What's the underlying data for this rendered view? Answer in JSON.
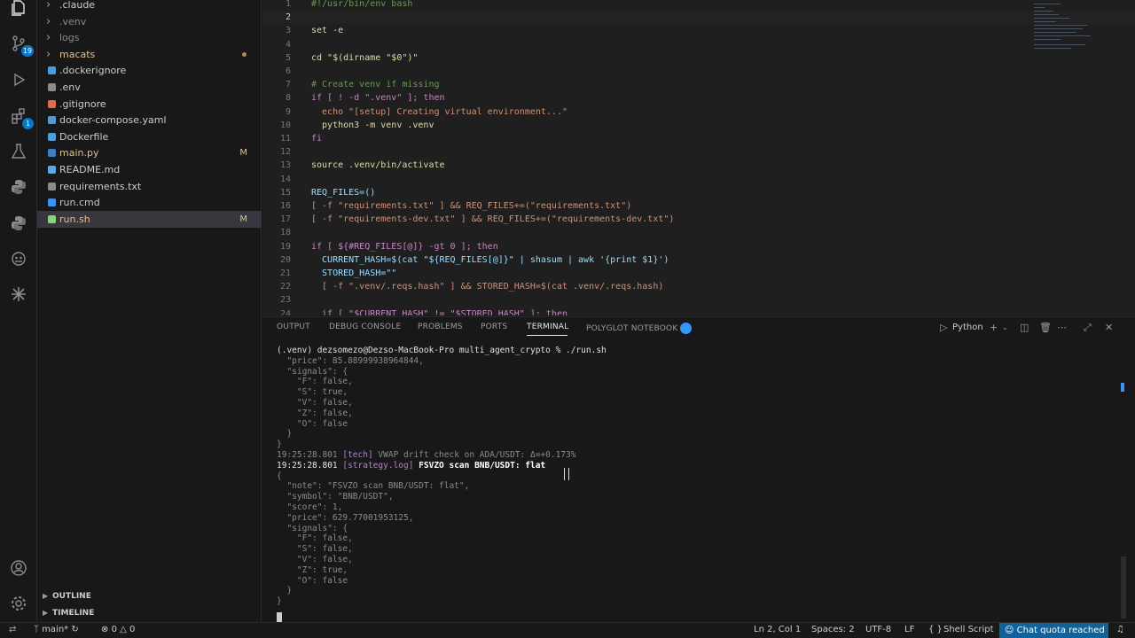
{
  "activity_bar": {
    "items": [
      {
        "name": "explorer-icon",
        "badge": ""
      },
      {
        "name": "source-control-icon",
        "badge": "19"
      },
      {
        "name": "run-debug-icon",
        "badge": ""
      },
      {
        "name": "extensions-icon",
        "badge": "1"
      },
      {
        "name": "testing-icon",
        "badge": ""
      },
      {
        "name": "python-icon",
        "badge": ""
      },
      {
        "name": "python-env-icon",
        "badge": ""
      },
      {
        "name": "copilot-icon",
        "badge": ""
      },
      {
        "name": "spark-icon",
        "badge": ""
      }
    ]
  },
  "explorer": {
    "items": [
      {
        "label": ".claude",
        "kind": "folder",
        "git": "",
        "color": "#cccccc"
      },
      {
        "label": ".venv",
        "kind": "folder",
        "git": "",
        "color": "#8b8b8b"
      },
      {
        "label": "logs",
        "kind": "folder",
        "git": "",
        "color": "#8b8b8b"
      },
      {
        "label": "macats",
        "kind": "folder",
        "git": "dot",
        "color": "#e2c08d"
      },
      {
        "label": ".dockerignore",
        "kind": "docker",
        "git": "",
        "color": "#cccccc"
      },
      {
        "label": ".env",
        "kind": "gear",
        "git": "",
        "color": "#cccccc"
      },
      {
        "label": ".gitignore",
        "kind": "git",
        "git": "",
        "color": "#cccccc"
      },
      {
        "label": "docker-compose.yaml",
        "kind": "docker",
        "git": "",
        "color": "#cccccc"
      },
      {
        "label": "Dockerfile",
        "kind": "docker",
        "git": "",
        "color": "#cccccc"
      },
      {
        "label": "main.py",
        "kind": "python",
        "git": "M",
        "color": "#e2c08d"
      },
      {
        "label": "README.md",
        "kind": "info",
        "git": "",
        "color": "#cccccc"
      },
      {
        "label": "requirements.txt",
        "kind": "text",
        "git": "",
        "color": "#cccccc"
      },
      {
        "label": "run.cmd",
        "kind": "cmd",
        "git": "",
        "color": "#cccccc"
      },
      {
        "label": "run.sh",
        "kind": "shell",
        "git": "M",
        "color": "#e2c08d"
      }
    ],
    "outline_label": "OUTLINE",
    "timeline_label": "TIMELINE"
  },
  "editor": {
    "lines": [
      {
        "n": "1",
        "text": "#!/usr/bin/env bash",
        "color": "#6a9955"
      },
      {
        "n": "2",
        "text": "",
        "color": "#cccccc"
      },
      {
        "n": "3",
        "text": "set -e",
        "color": "#dcdcaa"
      },
      {
        "n": "4",
        "text": "",
        "color": "#cccccc"
      },
      {
        "n": "5",
        "text": "cd \"$(dirname \"$0\")\"",
        "color": "#dcdcaa"
      },
      {
        "n": "6",
        "text": "",
        "color": "#cccccc"
      },
      {
        "n": "7",
        "text": "# Create venv if missing",
        "color": "#6a9955"
      },
      {
        "n": "8",
        "text": "if [ ! -d \".venv\" ]; then",
        "color": "#c586c0"
      },
      {
        "n": "9",
        "text": "  echo \"[setup] Creating virtual environment...\"",
        "color": "#ce9178"
      },
      {
        "n": "10",
        "text": "  python3 -m venv .venv",
        "color": "#dcdcaa"
      },
      {
        "n": "11",
        "text": "fi",
        "color": "#c586c0"
      },
      {
        "n": "12",
        "text": "",
        "color": "#cccccc"
      },
      {
        "n": "13",
        "text": "source .venv/bin/activate",
        "color": "#dcdcaa"
      },
      {
        "n": "14",
        "text": "",
        "color": "#cccccc"
      },
      {
        "n": "15",
        "text": "REQ_FILES=()",
        "color": "#9cdcfe"
      },
      {
        "n": "16",
        "text": "[ -f \"requirements.txt\" ] && REQ_FILES+=(\"requirements.txt\")",
        "color": "#ce9178"
      },
      {
        "n": "17",
        "text": "[ -f \"requirements-dev.txt\" ] && REQ_FILES+=(\"requirements-dev.txt\")",
        "color": "#ce9178"
      },
      {
        "n": "18",
        "text": "",
        "color": "#cccccc"
      },
      {
        "n": "19",
        "text": "if [ ${#REQ_FILES[@]} -gt 0 ]; then",
        "color": "#c586c0"
      },
      {
        "n": "20",
        "text": "  CURRENT_HASH=$(cat \"${REQ_FILES[@]}\" | shasum | awk '{print $1}')",
        "color": "#9cdcfe"
      },
      {
        "n": "21",
        "text": "  STORED_HASH=\"\"",
        "color": "#9cdcfe"
      },
      {
        "n": "22",
        "text": "  [ -f \".venv/.reqs.hash\" ] && STORED_HASH=$(cat .venv/.reqs.hash)",
        "color": "#ce9178"
      },
      {
        "n": "23",
        "text": "",
        "color": "#cccccc"
      },
      {
        "n": "24",
        "text": "  if [ \"$CURRENT_HASH\" != \"$STORED_HASH\" ]; then",
        "color": "#c586c0"
      }
    ]
  },
  "panel": {
    "tabs": [
      {
        "label": "OUTPUT",
        "active": false
      },
      {
        "label": "DEBUG CONSOLE",
        "active": false
      },
      {
        "label": "PROBLEMS",
        "active": false
      },
      {
        "label": "PORTS",
        "active": false
      },
      {
        "label": "TERMINAL",
        "active": true
      },
      {
        "label": "POLYGLOT NOTEBOOK",
        "active": false
      }
    ],
    "shell_label": "Python",
    "terminal_lines": [
      {
        "text": "(.venv) dezsomezo@Dezso-MacBook-Pro multi_agent_crypto % ./run.sh",
        "style": "prompt"
      },
      {
        "text": "  \"price\": 85.88999938964844,",
        "style": ""
      },
      {
        "text": "  \"signals\": {",
        "style": ""
      },
      {
        "text": "    \"F\": false,",
        "style": ""
      },
      {
        "text": "    \"S\": true,",
        "style": ""
      },
      {
        "text": "    \"V\": false,",
        "style": ""
      },
      {
        "text": "    \"Z\": false,",
        "style": ""
      },
      {
        "text": "    \"O\": false",
        "style": ""
      },
      {
        "text": "  }",
        "style": ""
      },
      {
        "text": "}",
        "style": ""
      },
      {
        "text": "19:25:28.801 [tech] VWAP drift check on ADA/USDT: Δ=+0.173%",
        "style": ""
      },
      {
        "text": "19:25:28.801 [strategy.log] FSVZO scan BNB/USDT: flat",
        "style": "bold"
      },
      {
        "text": "{",
        "style": ""
      },
      {
        "text": "  \"note\": \"FSVZO scan BNB/USDT: flat\",",
        "style": ""
      },
      {
        "text": "  \"symbol\": \"BNB/USDT\",",
        "style": ""
      },
      {
        "text": "  \"score\": 1,",
        "style": ""
      },
      {
        "text": "  \"price\": 629.77001953125,",
        "style": ""
      },
      {
        "text": "  \"signals\": {",
        "style": ""
      },
      {
        "text": "    \"F\": false,",
        "style": ""
      },
      {
        "text": "    \"S\": false,",
        "style": ""
      },
      {
        "text": "    \"V\": false,",
        "style": ""
      },
      {
        "text": "    \"Z\": true,",
        "style": ""
      },
      {
        "text": "    \"O\": false",
        "style": ""
      },
      {
        "text": "  }",
        "style": ""
      },
      {
        "text": "}",
        "style": ""
      }
    ]
  },
  "status_bar": {
    "remote_icon": "remote-icon",
    "branch": "main*",
    "errors": "0",
    "warnings": "0",
    "position": "Ln 2, Col 1",
    "spaces": "Spaces: 2",
    "encoding": "UTF-8",
    "eol": "LF",
    "language": "Shell Script",
    "chat_quota": "Chat quota reached"
  },
  "colors": {
    "accent": "#0078d4",
    "status_chat_bg": "#0e639c",
    "modified": "#e2c08d"
  }
}
